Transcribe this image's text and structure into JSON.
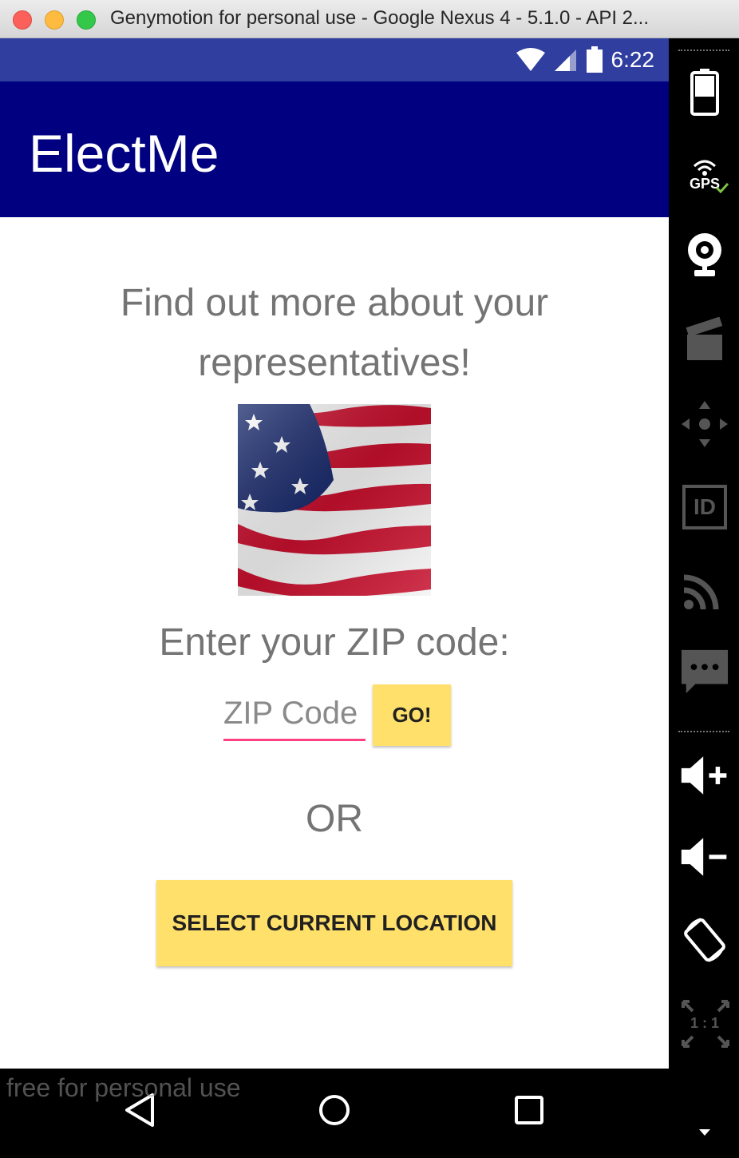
{
  "window": {
    "title": "Genymotion for personal use - Google Nexus 4 - 5.1.0 - API 2..."
  },
  "status_bar": {
    "time": "6:22",
    "icons": [
      "wifi-icon",
      "signal-icon",
      "battery-icon"
    ]
  },
  "app_bar": {
    "title": "ElectMe"
  },
  "main": {
    "headline": "Find out more about your representatives!",
    "zip_label": "Enter your ZIP code:",
    "zip_input": {
      "placeholder": "ZIP Code",
      "value": ""
    },
    "go_button": "GO!",
    "or_label": "OR",
    "location_button": "SELECT CURRENT LOCATION"
  },
  "nav_bar": {
    "buttons": [
      "back-icon",
      "home-icon",
      "recents-icon"
    ]
  },
  "watermark": "free for personal use",
  "side_panel": {
    "gps_label": "GPS",
    "id_label": "ID",
    "scale_label": "1 : 1",
    "buttons": [
      "battery-icon",
      "gps-icon",
      "webcam-icon",
      "capture-icon",
      "dpad-icon",
      "identifiers-icon",
      "cast-icon",
      "sms-icon",
      "volume-up-icon",
      "volume-down-icon",
      "rotate-icon",
      "scale-icon"
    ]
  },
  "colors": {
    "status_bar": "#303f9f",
    "app_bar": "#000080",
    "button": "#ffe06b",
    "input_underline": "#ff4081",
    "text_gray": "#747474"
  }
}
